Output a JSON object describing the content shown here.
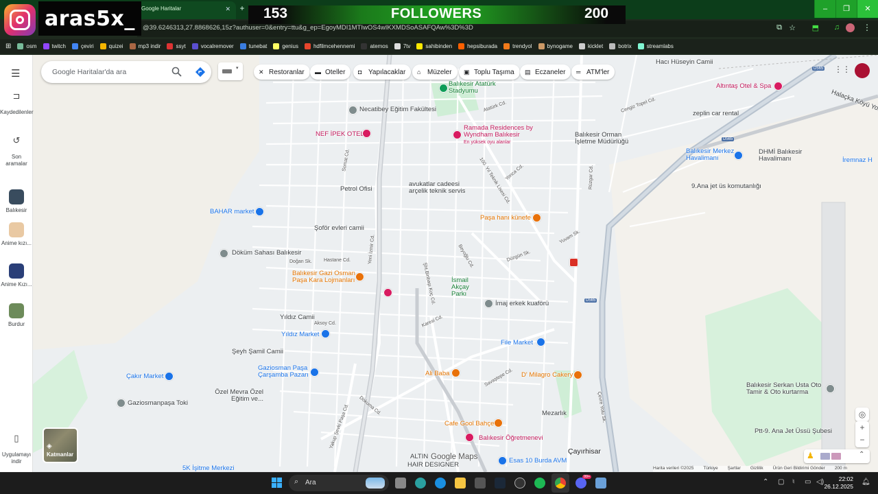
{
  "browser": {
    "tab_title": "Google Haritalar",
    "url": "@39.6246313,27.8868626,15z?authuser=0&entry=ttu&g_ep=EgoyMDI1MTIwOS4wIKXMDSoASAFQAw%3D%3D",
    "bookmarks": [
      "osm",
      "twitch",
      "çeviri",
      "quizei",
      "mp3 indir",
      "ssyt",
      "vocalremover",
      "tunebat",
      "genius",
      "hdfilmcehennemi",
      "atemos",
      "7tv",
      "sahibinden",
      "hepsiburada",
      "trendyol",
      "bynogame",
      "kicklet",
      "botrix",
      "streamlabs"
    ],
    "bookmark_colors": [
      "#7b9",
      "#9146ff",
      "#4285f4",
      "#f4b400",
      "#a64",
      "#d33",
      "#5b4fcf",
      "#3a7de0",
      "#ffff64",
      "#e8452c",
      "#333",
      "#ddd",
      "#ffe800",
      "#ff6000",
      "#f27a1a",
      "#c96",
      "#ccc",
      "#bbb",
      "#80f5d2"
    ]
  },
  "overlay": {
    "brand": "aras5x_",
    "current": "153",
    "label": "FOLLOWERS",
    "goal": "200"
  },
  "search": {
    "placeholder": "Google Haritalar'da ara"
  },
  "chips": [
    "Restoranlar",
    "Oteller",
    "Yapılacaklar",
    "Müzeler",
    "Toplu Taşıma",
    "Eczaneler",
    "ATM'ler"
  ],
  "rail": {
    "saved": "Kaydedilenler",
    "recent": "Son aramalar",
    "recent_places": [
      "Balıkesir",
      "Anime kızı...",
      "Anime Kızı...",
      "Burdur"
    ],
    "install": "Uygulamayı indir"
  },
  "layers_label": "Katmanlar",
  "places": {
    "hacihuseyin": "Hacı Hüseyin Camii",
    "altintas": "Altıntaş Otel & Spa",
    "stadyum": "Balıkesir Atatürk Stadyumu",
    "necatibey": "Necatibey Eğitim Fakültesi",
    "zeplin": "zeplin car rental",
    "halacka": "Halaçka Köyü Yolu",
    "nefipek": "NEF İPEK OTEL",
    "ramada": "Ramada Residences by Wyndham Balıkesir",
    "ramada_sub": "En yüksek oyu alanlar",
    "orman": "Balıkesir Orman İşletme Müdürlüğü",
    "havalimani": "Balıkesir Merkez Havalimanı",
    "dhmi": "DHMİ Balıkesir Havalimanı",
    "iremnaz": "İremnaz H",
    "avukatlar": "avukatlar cadeesi arçelik teknik servis",
    "petrol": "Petrol Ofisi",
    "anajet": "9.Ana jet üs komutanlığı",
    "bahar": "BAHAR market",
    "pasahani": "Paşa hanı künefe",
    "sofor": "Şoför evleri camii",
    "dokum": "Döküm Sahası Balıkesir",
    "gaziosman": "Balıkesir Gazi Osman Paşa Kara Lojmanları",
    "ismail": "İsmail Akçay Parkı",
    "imaj": "İmaj erkek kuaförü",
    "yildizcami": "Yıldız Camii",
    "yildizmarket": "Yıldız Market",
    "filemarket": "File Market",
    "seyh": "Şeyh Şamil Camii",
    "gaziosmanpasa_pazari": "Gaziosman Paşa Çarşamba Pazarı",
    "alibaba": "Ali Baba",
    "milagro": "D' Milagro Cakery",
    "cakir": "Çakır Market",
    "ozelmevra": "Özel Mevra Özel Eğitim ve...",
    "gaziosmanpasa_toki": "Gaziosmanpaşa Toki",
    "serkan": "Balıkesir Serkan Usta Oto Tamir & Oto kurtarma",
    "cafegool": "Cafe Gool Bahçe",
    "ogretmenevi": "Balıkesir Öğretmenevi",
    "mezarlik": "Mezarlık",
    "cayirhisar": "Çayırhisar",
    "ptt": "Ptt-9. Ana Jet Üssü Şubesi",
    "esas": "Esas 10 Burda AVM",
    "altin": "ALTIN",
    "hair": "HAIR DESIGNER",
    "isitme": "5K İşitme Merkezi",
    "google": "Google Maps"
  },
  "roads": [
    "Atatürk Cd.",
    "Yeni İzmir Cd.",
    "100. Yıl Teknik Lisesi Cd.",
    "Rüzgar Cd.",
    "Yuvam Sk.",
    "Düzgün Sk.",
    "Beyoğlu Cd.",
    "Karesi Cd.",
    "Savaştepe Cd.",
    "Dokuma Cd.",
    "Yakup Şevki Paşa Cd.",
    "Çevre Yolu Sk.",
    "Cengiz Topel Cd.",
    "Hastane Cd.",
    "Doğan Sk.",
    "Aksoy Cd.",
    "Yonca Cd.",
    "Şht.Binbaşı Koç Cd.",
    "Somat Cd."
  ],
  "shields": [
    "D565",
    "D565",
    "D565"
  ],
  "attribution": [
    "Harita verileri ©2025",
    "Türkiye",
    "Şartlar",
    "Gizlilik",
    "Ürün Geri Bildirimi Gönder",
    "200 m"
  ],
  "taskbar": {
    "search": "Ara",
    "time": "22:02",
    "date": "26.12.2025",
    "badge": "99+"
  }
}
